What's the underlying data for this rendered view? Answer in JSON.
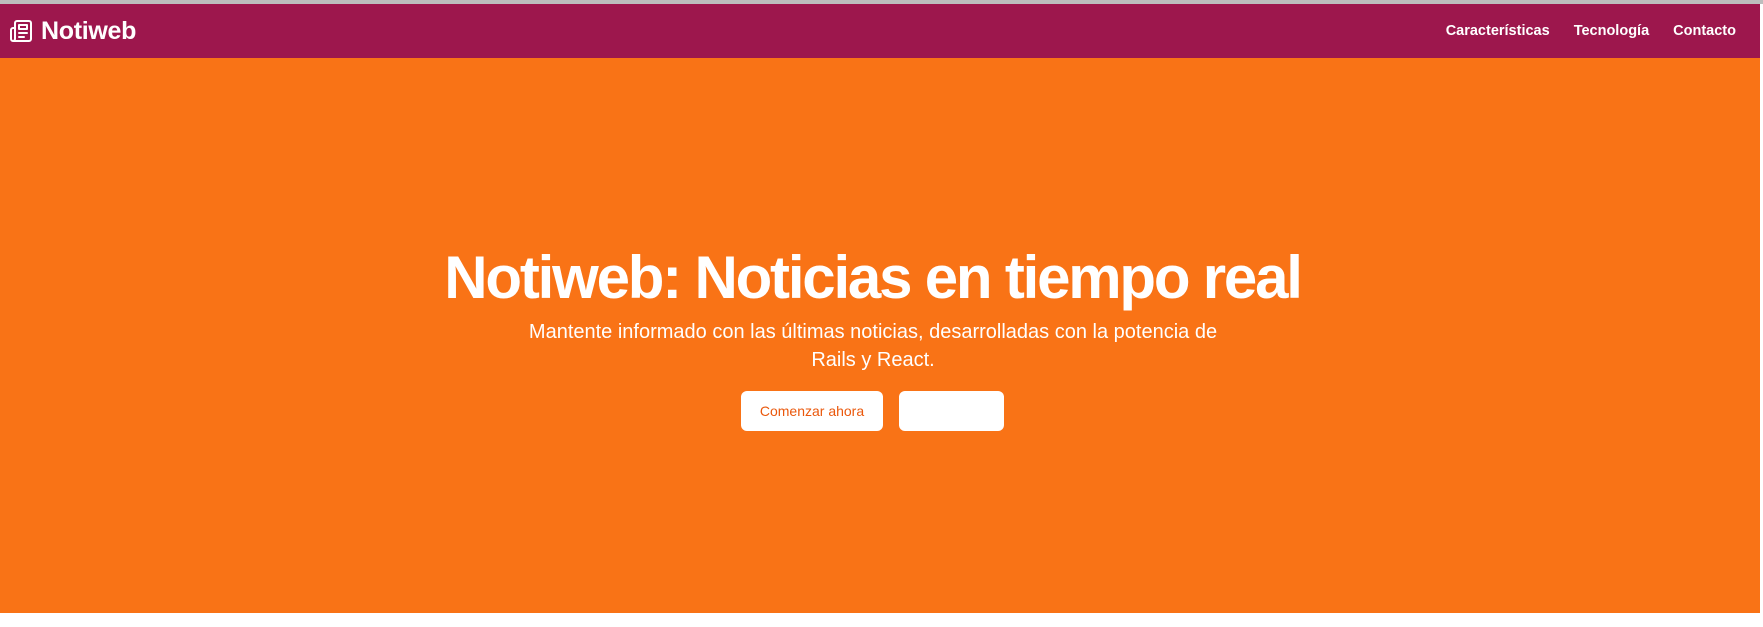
{
  "navbar": {
    "brand_icon": "newspaper-icon",
    "brand_name": "Notiweb",
    "links": [
      {
        "label": "Características"
      },
      {
        "label": "Tecnología"
      },
      {
        "label": "Contacto"
      }
    ]
  },
  "hero": {
    "title": "Notiweb: Noticias en tiempo real",
    "subtitle": "Mantente informado con las últimas noticias, desarrolladas con la potencia de Rails y React.",
    "primary_button": "Comenzar ahora",
    "secondary_button": ""
  },
  "colors": {
    "navbar_bg": "#9d174d",
    "hero_bg": "#f97316",
    "button_text": "#ea580c",
    "text": "#ffffff"
  }
}
